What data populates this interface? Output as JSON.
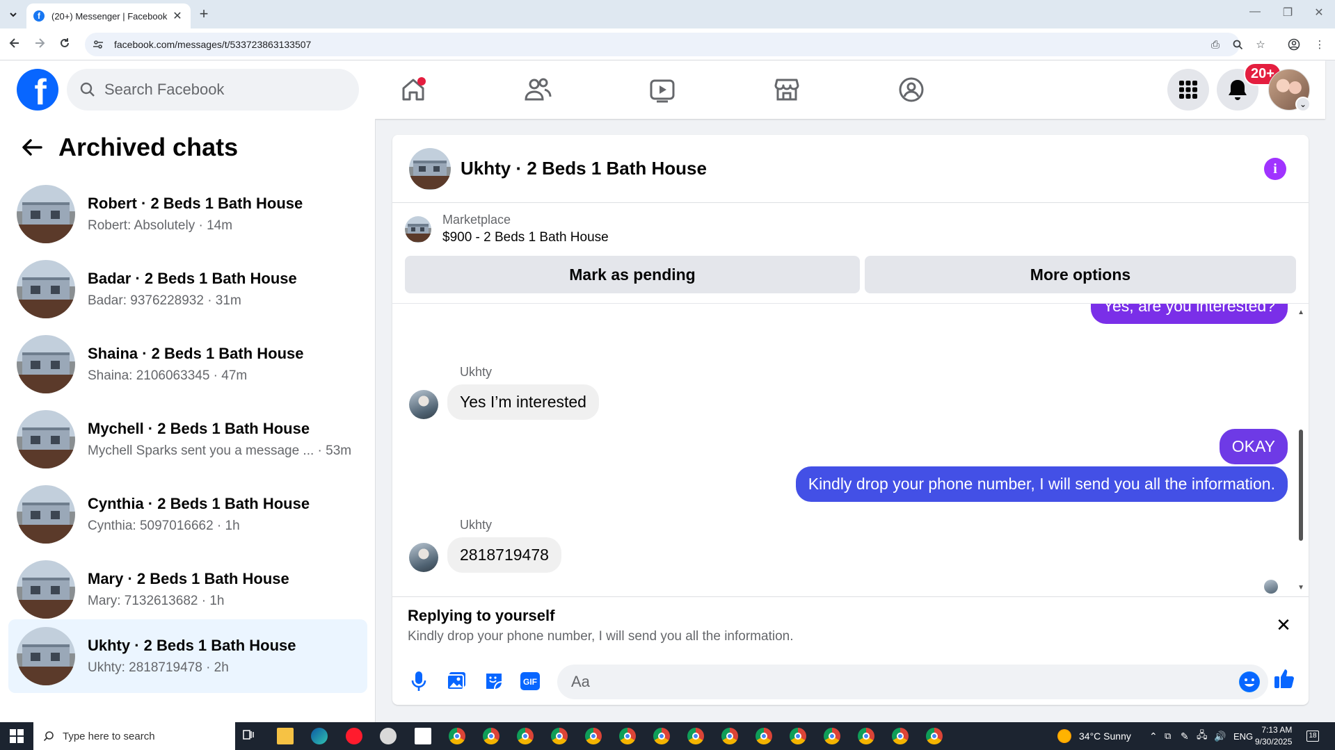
{
  "browser": {
    "tab_title": "(20+) Messenger | Facebook",
    "url": "facebook.com/messages/t/533723863133507",
    "tab_favicon_letter": "f",
    "new_tab_glyph": "+",
    "tab_close_glyph": "✕"
  },
  "fb_header": {
    "logo_letter": "f",
    "search_placeholder": "Search Facebook",
    "notification_badge": "20+",
    "nav_icons": [
      "home-icon",
      "friends-icon",
      "video-icon",
      "marketplace-icon",
      "groups-icon"
    ],
    "right_icons": [
      "menu-grid-icon",
      "bell-icon",
      "profile-avatar"
    ]
  },
  "sidebar": {
    "title": "Archived chats",
    "chats": [
      {
        "name": "Robert · 2 Beds 1 Bath House",
        "preview": "Robert: Absolutely · 14m"
      },
      {
        "name": "Badar · 2 Beds 1 Bath House",
        "preview": "Badar: 9376228932 · 31m"
      },
      {
        "name": "Shaina · 2 Beds 1 Bath House",
        "preview": "Shaina: 2106063345 · 47m"
      },
      {
        "name": "Mychell · 2 Beds 1 Bath House",
        "preview": "Mychell Sparks sent you a message ... · 53m"
      },
      {
        "name": "Cynthia · 2 Beds 1 Bath House",
        "preview": "Cynthia: 5097016662 · 1h"
      },
      {
        "name": "Mary · 2 Beds 1 Bath House",
        "preview": "Mary: 7132613682 · 1h"
      },
      {
        "name": "Ukhty · 2 Beds 1 Bath House",
        "preview": "Ukhty: 2818719478 · 2h",
        "active": true
      }
    ]
  },
  "conversation": {
    "title": "Ukhty · 2 Beds 1 Bath House",
    "info_glyph": "i",
    "marketplace_label": "Marketplace",
    "marketplace_item": "$900 - 2 Beds 1 Bath House",
    "mark_pending_label": "Mark as pending",
    "more_options_label": "More options",
    "messages": [
      {
        "from": "me",
        "text": "Yes, are you interested?"
      },
      {
        "from": "Ukhty",
        "sender_label": "Ukhty",
        "text": "Yes I’m interested"
      },
      {
        "from": "me",
        "text": "OKAY"
      },
      {
        "from": "me",
        "text": "Kindly drop your phone number, I will send you all the information."
      },
      {
        "from": "Ukhty",
        "sender_label": "Ukhty",
        "text": "2818719478"
      }
    ],
    "reply": {
      "title": "Replying to yourself",
      "text": "Kindly drop your phone number, I will send you all the information.",
      "close_glyph": "✕"
    },
    "composer_placeholder": "Aa",
    "composer_icons": [
      "microphone-icon",
      "photo-icon",
      "sticker-icon",
      "gif-icon",
      "emoji-icon",
      "like-icon"
    ],
    "gif_label": "GIF"
  },
  "taskbar": {
    "search_placeholder": "Type here to search",
    "weather": "34°C  Sunny",
    "language": "ENG",
    "time": "7:13 AM",
    "date": "9/30/2025",
    "notification_count": "18"
  },
  "colors": {
    "fb_blue": "#0866ff",
    "messenger_violet": "#a033ff",
    "bubble_blue": "#4350e6",
    "badge_red": "#e41e3f"
  }
}
